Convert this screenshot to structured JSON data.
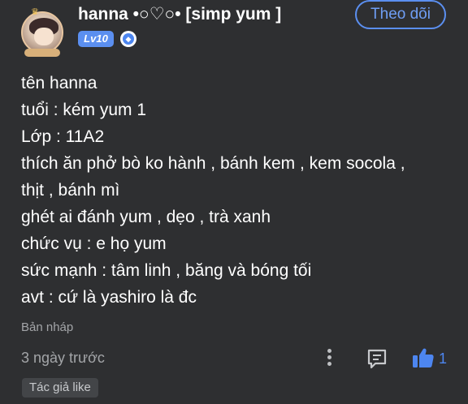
{
  "post": {
    "author": {
      "username": "hanna •○♡○• [simp yum ]",
      "level": "Lv10",
      "avatar_icon": "anime-avatar-icon",
      "verify_icon": "amino-badge-icon"
    },
    "follow_label": "Theo dõi",
    "lines": [
      "tên hanna",
      "tuổi : kém yum 1",
      "Lớp : 11A2",
      "thích ăn phở bò ko hành , bánh kem , kem socola ,",
      "thịt , bánh mì",
      "ghét ai đánh yum , dẹo , trà xanh",
      "chức vụ : e họ yum",
      "sức mạnh : tâm linh , băng và bóng tối",
      "avt : cứ là yashiro là đc"
    ],
    "draft_label": "Bản nháp",
    "timestamp": "3 ngày trước",
    "like_count": "1",
    "author_like_label": "Tác giả like"
  },
  "colors": {
    "background": "#2e2f31",
    "accent": "#5b8ff0",
    "muted_text": "#a3a5a8"
  }
}
